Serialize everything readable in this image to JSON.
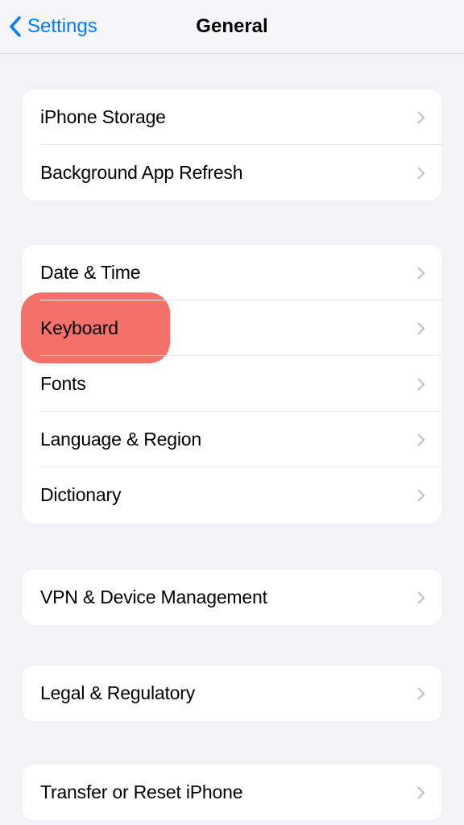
{
  "nav": {
    "back_label": "Settings",
    "title": "General"
  },
  "groups": [
    {
      "items": [
        {
          "label": "iPhone Storage",
          "name": "iphone-storage"
        },
        {
          "label": "Background App Refresh",
          "name": "background-app-refresh"
        }
      ]
    },
    {
      "items": [
        {
          "label": "Date & Time",
          "name": "date-time"
        },
        {
          "label": "Keyboard",
          "name": "keyboard",
          "highlighted": true
        },
        {
          "label": "Fonts",
          "name": "fonts"
        },
        {
          "label": "Language & Region",
          "name": "language-region"
        },
        {
          "label": "Dictionary",
          "name": "dictionary"
        }
      ]
    },
    {
      "items": [
        {
          "label": "VPN & Device Management",
          "name": "vpn-device-management"
        }
      ]
    },
    {
      "items": [
        {
          "label": "Legal & Regulatory",
          "name": "legal-regulatory"
        }
      ]
    },
    {
      "items": [
        {
          "label": "Transfer or Reset iPhone",
          "name": "transfer-reset-iphone"
        }
      ]
    }
  ]
}
